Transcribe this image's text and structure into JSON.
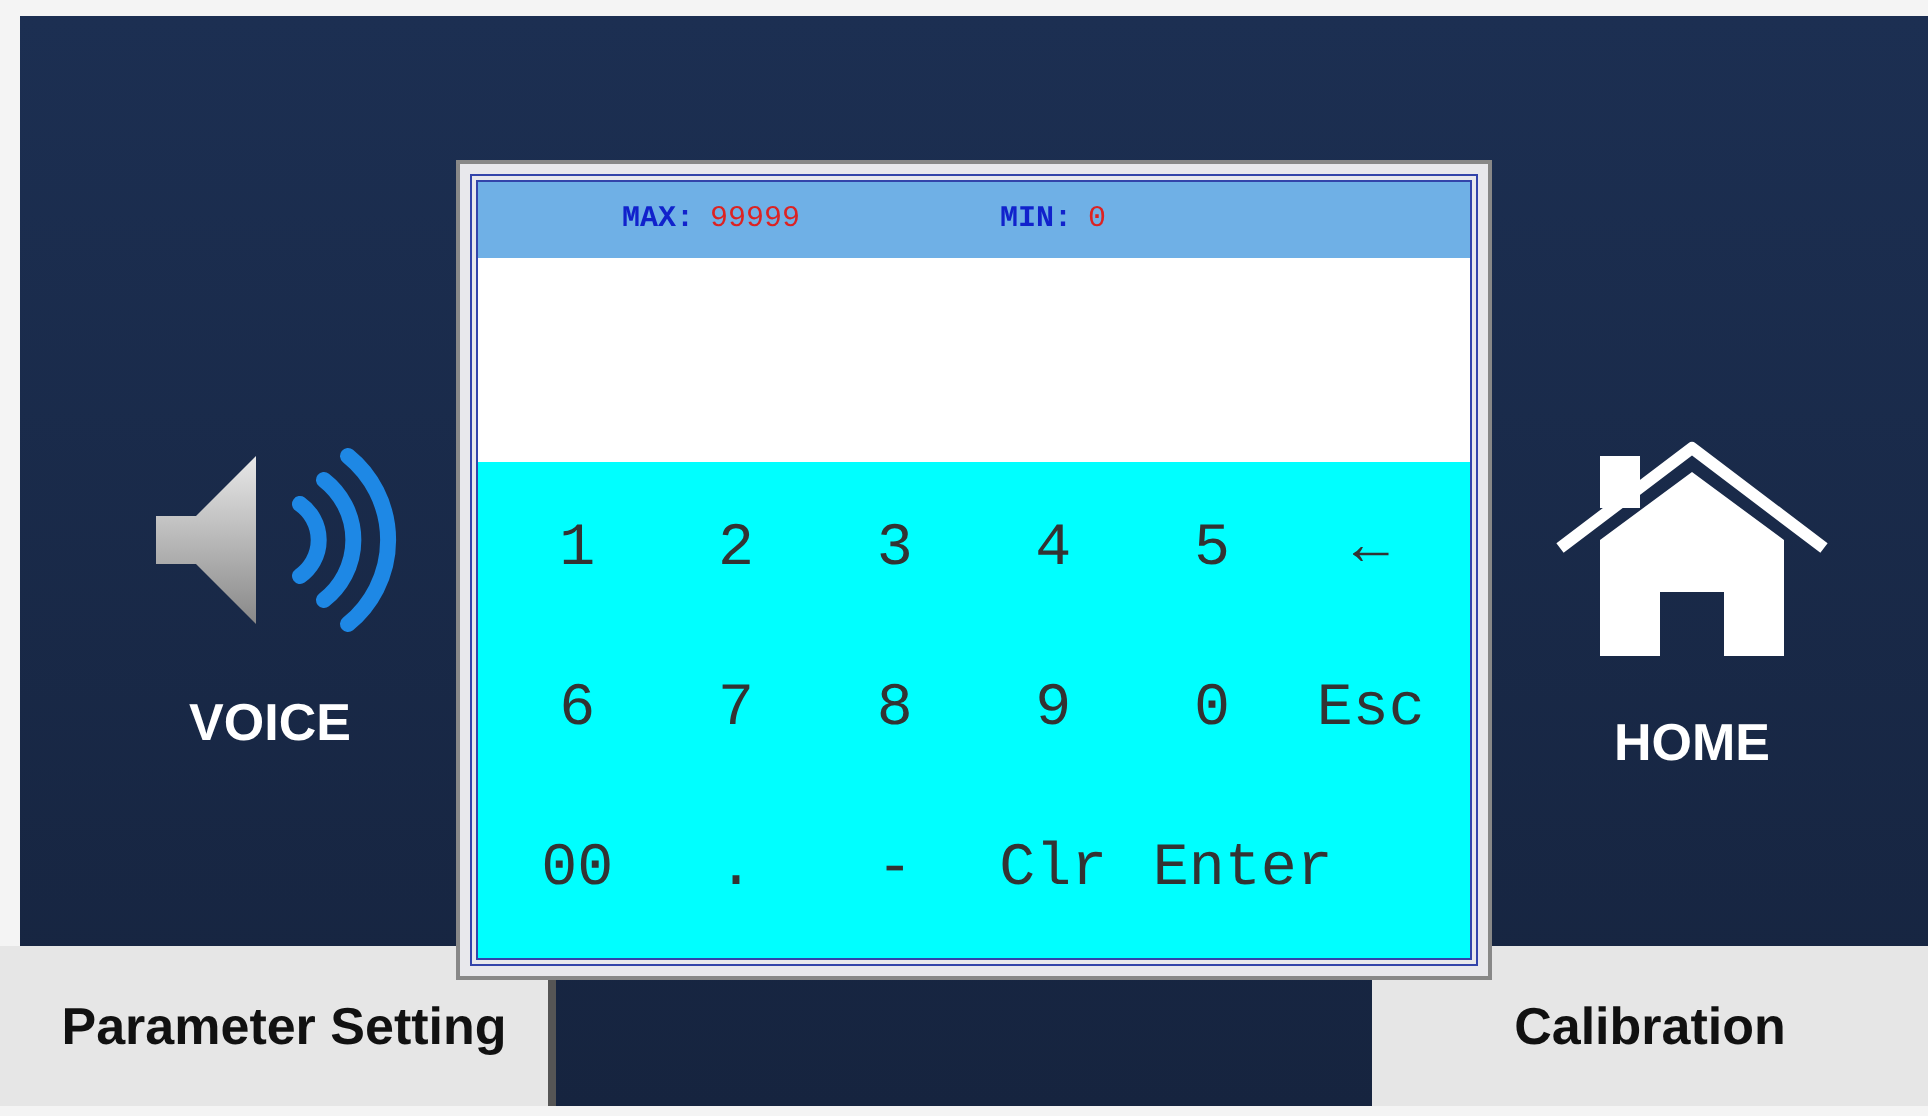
{
  "side_buttons": [
    {
      "kind": "voice",
      "label": "VOICE"
    },
    {
      "kind": "home",
      "label": "HOME"
    }
  ],
  "bottom_buttons": [
    {
      "label": "Parameter Setting"
    },
    {
      "label": "Calibration"
    }
  ],
  "keypad": {
    "max_label": "MAX:",
    "max_value": "99999",
    "min_label": "MIN:",
    "min_value": "0",
    "keys": [
      {
        "label": "1"
      },
      {
        "label": "2"
      },
      {
        "label": "3"
      },
      {
        "label": "4"
      },
      {
        "label": "5"
      },
      {
        "label": "←"
      },
      {
        "label": "6"
      },
      {
        "label": "7"
      },
      {
        "label": "8"
      },
      {
        "label": "9"
      },
      {
        "label": "0"
      },
      {
        "label": "Esc"
      },
      {
        "label": "00"
      },
      {
        "label": "."
      },
      {
        "label": "-"
      },
      {
        "label": "Clr"
      },
      {
        "label": "Enter",
        "kind": "wide"
      }
    ]
  }
}
